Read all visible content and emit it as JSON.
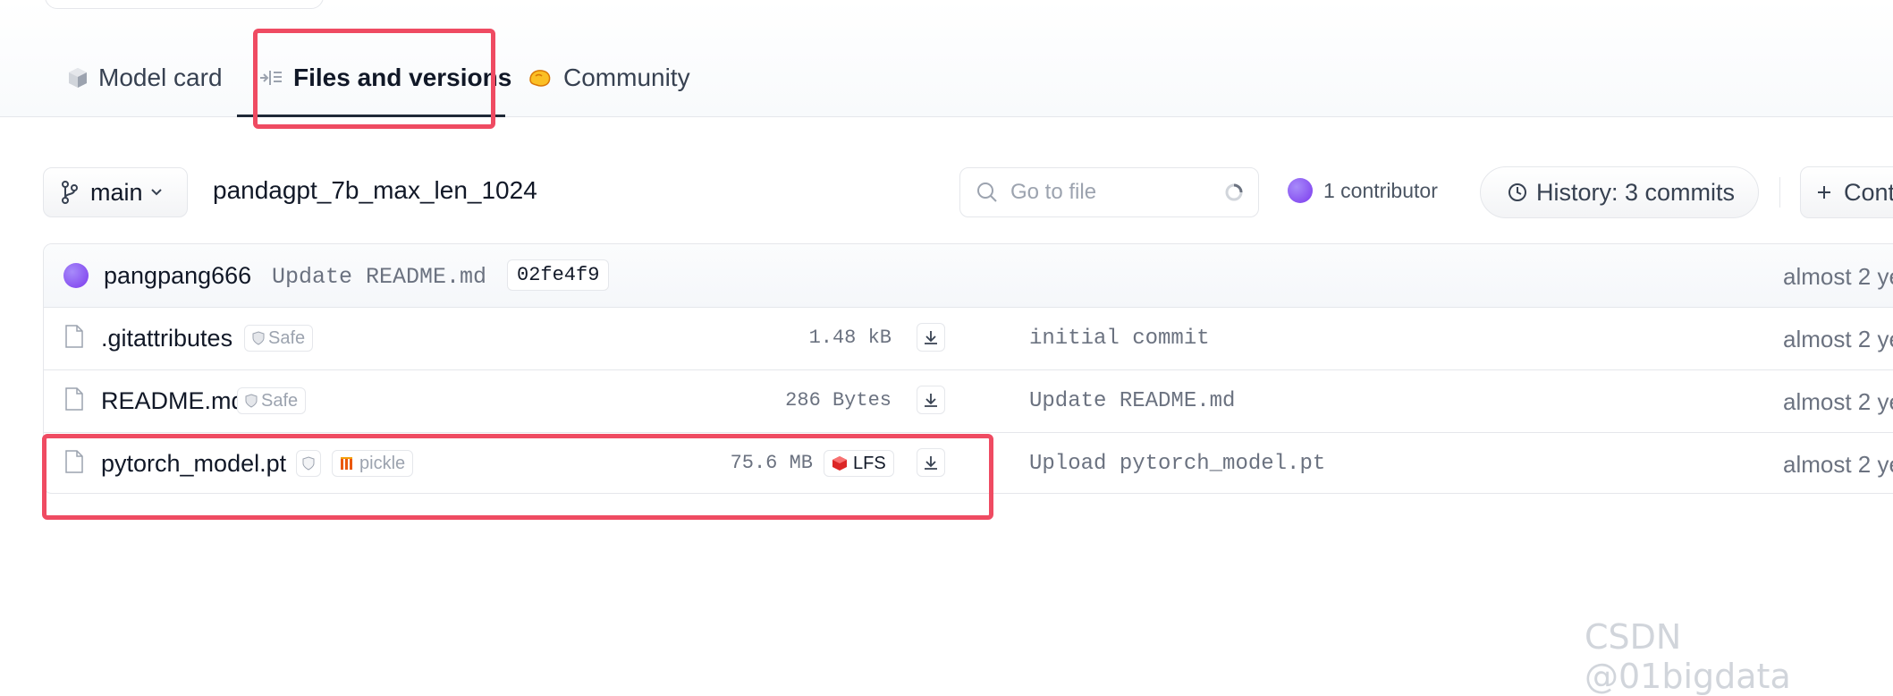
{
  "tabs": [
    {
      "label": "Model card"
    },
    {
      "label": "Files and versions"
    },
    {
      "label": "Community"
    }
  ],
  "toolbar": {
    "branch": "main",
    "path": "pandagpt_7b_max_len_1024",
    "search_placeholder": "Go to file",
    "contributors": "1 contributor",
    "history": "History: 3 commits",
    "contribute": "Cont"
  },
  "last_commit": {
    "author": "pangpang666",
    "message": "Update README.md",
    "hash": "02fe4f9",
    "date": "almost 2 ye"
  },
  "files": [
    {
      "name": ".gitattributes",
      "badge": "Safe",
      "size": "1.48 kB",
      "commit": "initial commit",
      "date": "almost 2 ye"
    },
    {
      "name": "README.md",
      "badge": "Safe",
      "size": "286 Bytes",
      "commit": "Update README.md",
      "date": "almost 2 ye"
    },
    {
      "name": "pytorch_model.pt",
      "badge": "pickle",
      "size": "75.6 MB",
      "lfs": "LFS",
      "commit": "Upload pytorch_model.pt",
      "date": "almost 2 ye"
    }
  ],
  "watermark": "CSDN @01bigdata",
  "colors": {
    "highlight": "#ef4b62",
    "avatar": "#7c3aed",
    "lfs": "#dc2626",
    "pickle": "#ea580c"
  },
  "icons": [
    "cube-icon",
    "files-icon",
    "community-icon",
    "branch-icon",
    "chevron-down-icon",
    "search-icon",
    "spinner-icon",
    "clock-icon",
    "plus-icon",
    "file-icon",
    "shield-icon",
    "download-icon"
  ]
}
